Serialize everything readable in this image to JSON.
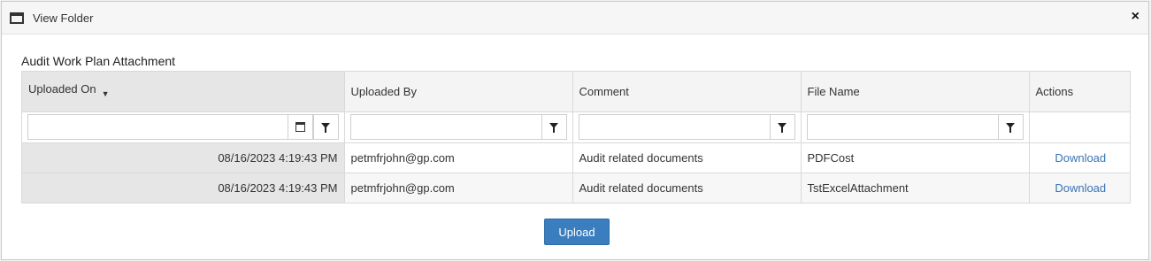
{
  "dialog": {
    "title": "View Folder",
    "close_icon": "×"
  },
  "section": {
    "title": "Audit Work Plan Attachment"
  },
  "grid": {
    "columns": [
      "Uploaded On",
      "Uploaded By",
      "Comment",
      "File Name",
      "Actions"
    ],
    "sort_indicator": "▼",
    "rows": [
      {
        "uploaded_on": "08/16/2023 4:19:43 PM",
        "uploaded_by": "petmfrjohn@gp.com",
        "comment": "Audit related documents",
        "file_name": "PDFCost",
        "action": "Download"
      },
      {
        "uploaded_on": "08/16/2023 4:19:43 PM",
        "uploaded_by": "petmfrjohn@gp.com",
        "comment": "Audit related documents",
        "file_name": "TstExcelAttachment",
        "action": "Download"
      }
    ]
  },
  "footer": {
    "upload_label": "Upload"
  },
  "colors": {
    "primary": "#3a7ebf",
    "link": "#3a73b6"
  }
}
